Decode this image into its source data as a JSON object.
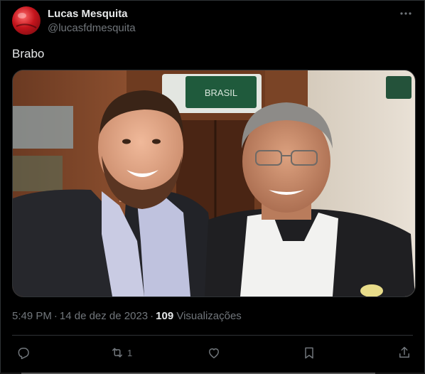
{
  "user": {
    "name": "Lucas Mesquita",
    "handle": "@lucasfdmesquita"
  },
  "tweet": {
    "text": "Brabo",
    "time": "5:49 PM",
    "date": "14 de dez de 2023",
    "views_count": "109",
    "views_label": "Visualizações"
  },
  "media": {
    "description_icon": "photo",
    "sign_text": "BRASIL"
  },
  "actions": {
    "reply_count": "",
    "retweet_count": "1",
    "like_count": "",
    "bookmark_count": ""
  },
  "colors": {
    "background": "#000000",
    "text_primary": "#e7e9ea",
    "text_secondary": "#71767b",
    "border": "#2f3336"
  },
  "icons": [
    "more-icon",
    "reply-icon",
    "retweet-icon",
    "like-icon",
    "bookmark-icon",
    "share-icon"
  ]
}
